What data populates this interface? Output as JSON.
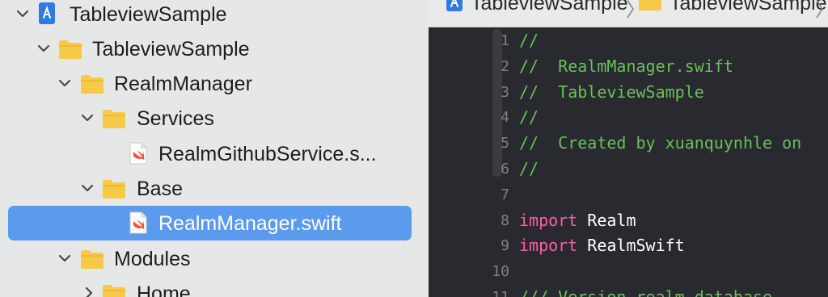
{
  "navigator": {
    "items": [
      {
        "label": "TableviewSample",
        "icon": "xcode-project-icon",
        "expanded": true
      },
      {
        "label": "TableviewSample",
        "icon": "folder-icon",
        "expanded": true
      },
      {
        "label": "RealmManager",
        "icon": "folder-icon",
        "expanded": true
      },
      {
        "label": "Services",
        "icon": "folder-icon",
        "expanded": true
      },
      {
        "label": "RealmGithubService.s...",
        "icon": "swift-file-icon"
      },
      {
        "label": "Base",
        "icon": "folder-icon",
        "expanded": true
      },
      {
        "label": "RealmManager.swift",
        "icon": "swift-file-icon",
        "selected": true
      },
      {
        "label": "Modules",
        "icon": "folder-icon",
        "expanded": true
      },
      {
        "label": "Home",
        "icon": "folder-icon",
        "expanded": false
      }
    ]
  },
  "jumpbar": {
    "items": [
      "TableviewSample",
      "TableviewSample"
    ]
  },
  "editor": {
    "lines": [
      {
        "num": "1",
        "text": "//"
      },
      {
        "num": "2",
        "text": "//  RealmManager.swift"
      },
      {
        "num": "3",
        "text": "//  TableviewSample"
      },
      {
        "num": "4",
        "text": "//"
      },
      {
        "num": "5",
        "text": "//  Created by xuanquynhle on"
      },
      {
        "num": "6",
        "text": "//"
      },
      {
        "num": "7",
        "text": ""
      },
      {
        "num": "8",
        "kw": "import",
        "text": " Realm"
      },
      {
        "num": "9",
        "kw": "import",
        "text": " RealmSwift"
      },
      {
        "num": "10",
        "text": ""
      },
      {
        "num": "11",
        "text": "/// Version realm database"
      }
    ]
  },
  "colors": {
    "selection": "#5a9bed",
    "editor_bg": "#292a30",
    "comment": "#6bbf59",
    "keyword": "#fc5fa3",
    "folder": "#f7c948"
  }
}
